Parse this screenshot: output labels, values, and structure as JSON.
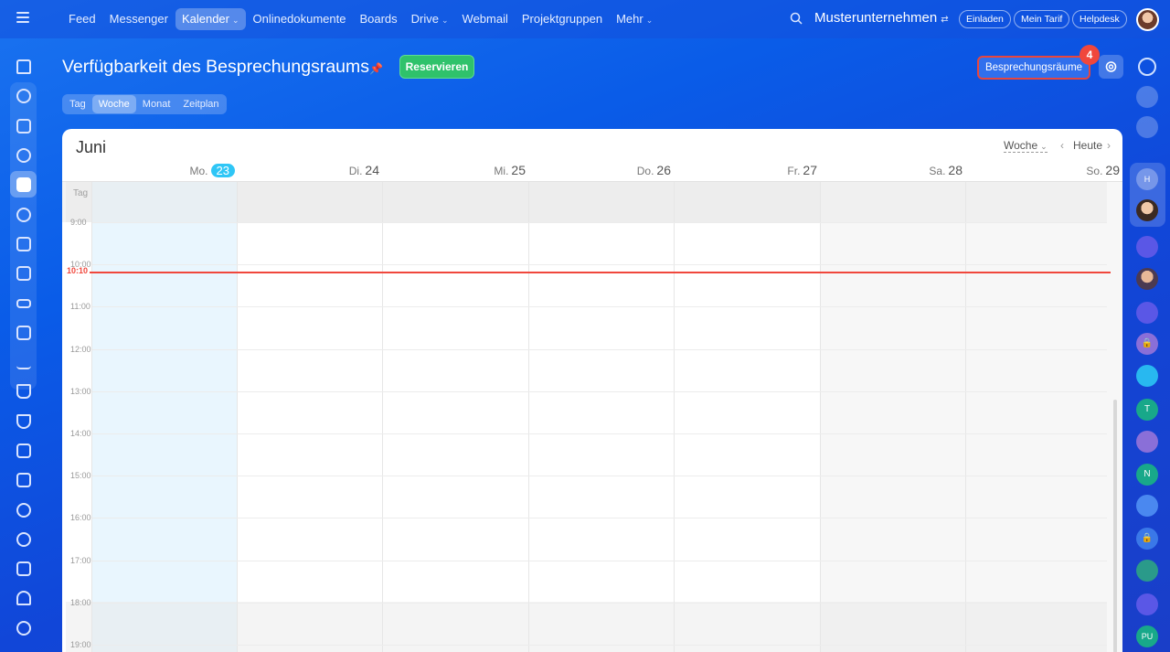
{
  "topbar": {
    "nav": [
      {
        "label": "Feed",
        "active": false,
        "chevron": false
      },
      {
        "label": "Messenger",
        "active": false,
        "chevron": false
      },
      {
        "label": "Kalender",
        "active": true,
        "chevron": true
      },
      {
        "label": "Onlinedokumente",
        "active": false,
        "chevron": false
      },
      {
        "label": "Boards",
        "active": false,
        "chevron": false
      },
      {
        "label": "Drive",
        "active": false,
        "chevron": true
      },
      {
        "label": "Webmail",
        "active": false,
        "chevron": false
      },
      {
        "label": "Projektgruppen",
        "active": false,
        "chevron": false
      },
      {
        "label": "Mehr",
        "active": false,
        "chevron": true
      }
    ],
    "company": "Musterunternehmen",
    "invite": "Einladen",
    "plan": "Mein Tarif",
    "helpdesk": "Helpdesk"
  },
  "page": {
    "title": "Verfügbarkeit des Besprechungsraums",
    "reserve": "Reservieren",
    "rooms": "Besprechungsräume",
    "rooms_badge": "4",
    "views": [
      "Tag",
      "Woche",
      "Monat",
      "Zeitplan"
    ],
    "active_view": "Woche"
  },
  "calendar": {
    "month": "Juni",
    "mode": "Woche",
    "today": "Heute",
    "allday_label": "Tag",
    "now_label": "10:10",
    "days": [
      {
        "wd": "Mo.",
        "num": "23",
        "today": true
      },
      {
        "wd": "Di.",
        "num": "24",
        "today": false
      },
      {
        "wd": "Mi.",
        "num": "25",
        "today": false
      },
      {
        "wd": "Do.",
        "num": "26",
        "today": false
      },
      {
        "wd": "Fr.",
        "num": "27",
        "today": false
      },
      {
        "wd": "Sa.",
        "num": "28",
        "today": false
      },
      {
        "wd": "So.",
        "num": "29",
        "today": false
      }
    ],
    "hours": [
      "9:00",
      "10:00",
      "11:00",
      "12:00",
      "13:00",
      "14:00",
      "15:00",
      "16:00",
      "17:00",
      "18:00",
      "19:00"
    ]
  },
  "rightbar": {
    "initials": [
      "H",
      "T",
      "N",
      "PU"
    ]
  },
  "colors": {
    "accent_green": "#2fc26b",
    "badge_red": "#f0473c",
    "today_blue": "#2fc6f6",
    "now_line": "#f0473c"
  }
}
